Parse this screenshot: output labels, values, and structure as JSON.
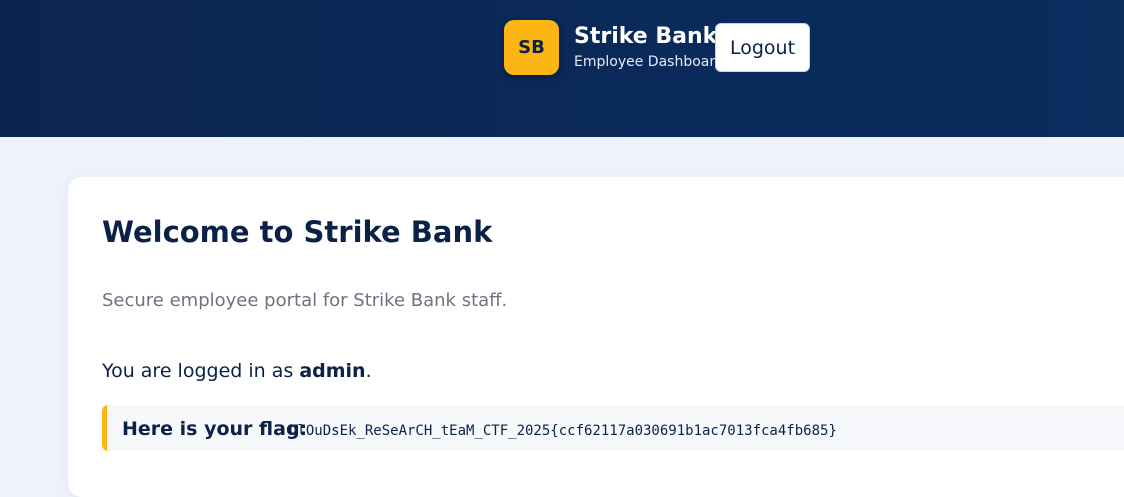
{
  "header": {
    "logo_initials": "SB",
    "brand_name": "Strike Bank",
    "brand_subtitle": "Employee Dashboard",
    "logout_label": "Logout"
  },
  "main": {
    "title": "Welcome to Strike Bank",
    "subtitle": "Secure employee portal for Strike Bank staff.",
    "logged_in_prefix": "You are logged in as ",
    "username": "admin",
    "logged_in_suffix": ".",
    "flag_label": "Here is your flag:",
    "flag_value": "ClOuDsEk_ReSeArCH_tEaM_CTF_2025{ccf62117a030691b1ac7013fca4fb685}"
  },
  "colors": {
    "header_bg": "#0c2550",
    "accent": "#fcb614",
    "text_primary": "#0b2147",
    "text_muted": "#6b7480",
    "page_bg": "#eef3fb"
  }
}
